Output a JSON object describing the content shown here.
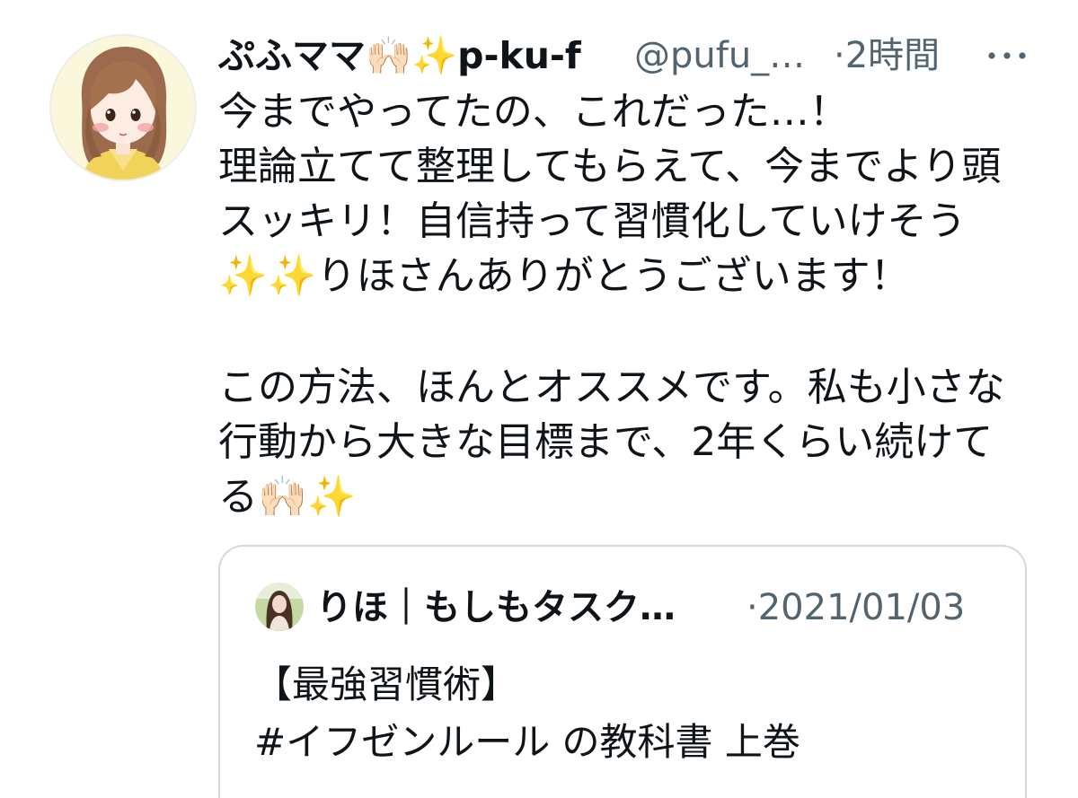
{
  "tweet": {
    "author": {
      "display_name": "ぷふママ🙌🏻✨p-ku-f",
      "handle": "@pufu_…",
      "separator": "·",
      "time": "2時間"
    },
    "more_icon": "more-horizontal-icon",
    "paragraphs": [
      [
        "今までやってたの、これだった…！",
        "理論立てて整理してもらえて、今までより頭",
        "スッキリ！自信持って習慣化していけそう",
        "✨✨りほさんありがとうございます！"
      ],
      [
        "この方法、ほんとオススメです。私も小さな",
        "行動から大きな目標まで、2年くらい続けて",
        "る🙌🏻✨"
      ]
    ],
    "quoted": {
      "author_name": "りほ｜もしもタスク…",
      "separator": "·",
      "date": "2021/01/03",
      "body_lines": [
        "【最強習慣術】",
        "#イフゼンルール の教科書 上巻"
      ]
    }
  },
  "colors": {
    "background": "#ffffff",
    "text": "#0f1419",
    "secondary_text": "#536471",
    "card_border": "#cfd9de"
  }
}
